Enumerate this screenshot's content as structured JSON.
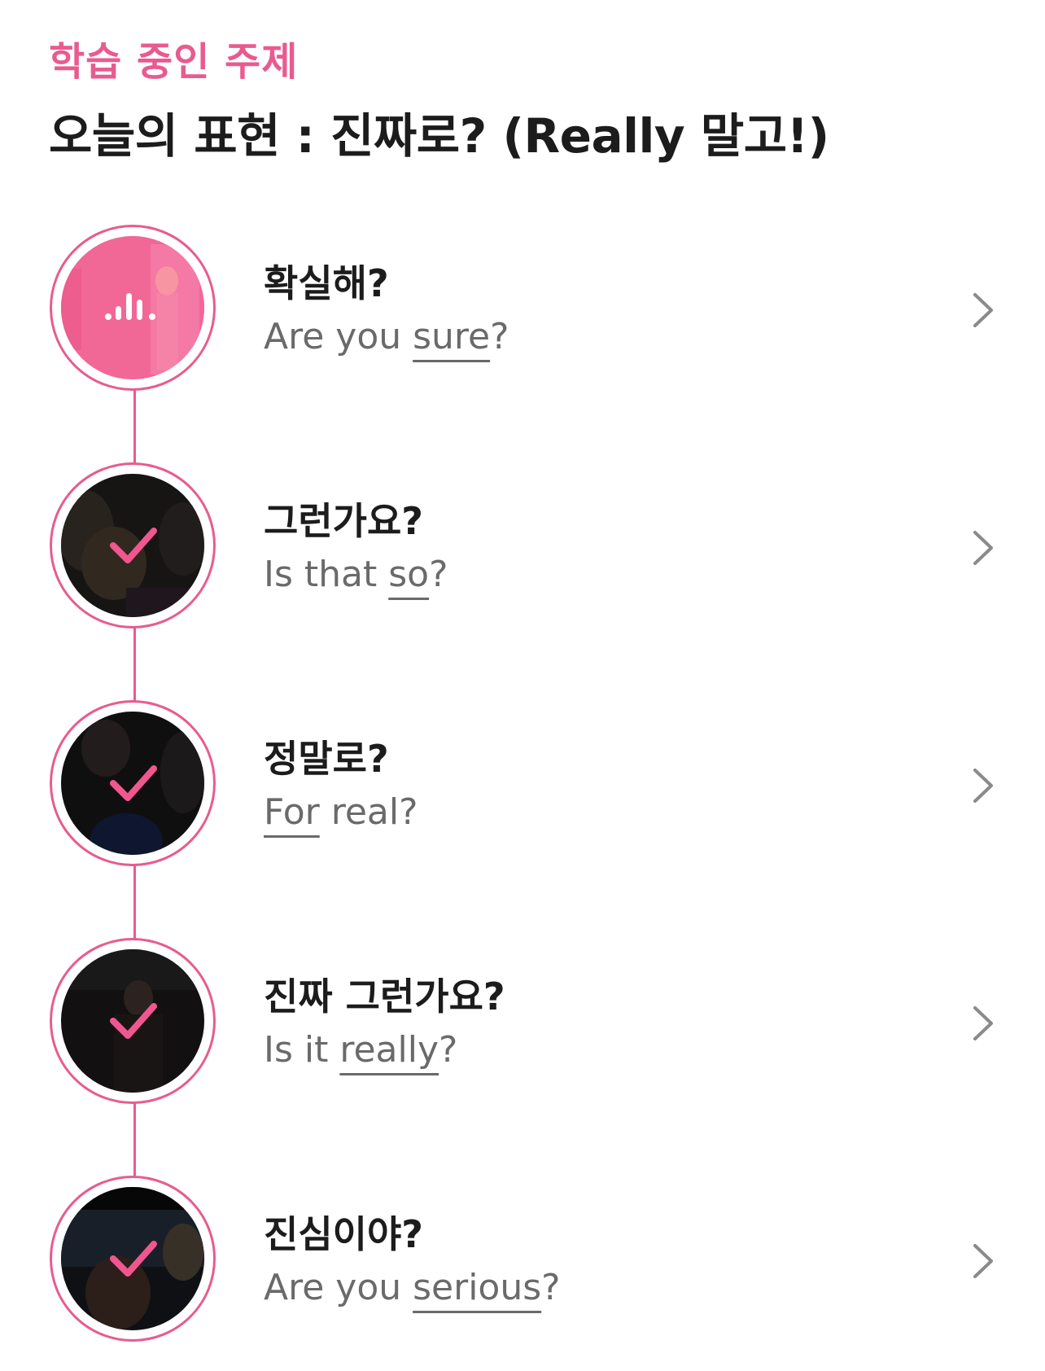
{
  "header": {
    "eyebrow": "학습 중인 주제",
    "title": "오늘의 표현 : 진짜로? (Really 말고!)"
  },
  "colors": {
    "accent": "#e85b8f",
    "text_primary": "#1c1c1c",
    "text_secondary": "#6a6a6a"
  },
  "items": [
    {
      "ko": "확실해?",
      "en_pre": "Are you ",
      "en_u": "sure",
      "en_post": "?",
      "state": "playing",
      "icon": "audio-wave-icon"
    },
    {
      "ko": "그런가요?",
      "en_pre": "Is that ",
      "en_u": "so",
      "en_post": "?",
      "state": "completed",
      "icon": "check-icon"
    },
    {
      "ko": "정말로?",
      "en_pre": "",
      "en_u": "For",
      "en_post": " real?",
      "state": "completed",
      "icon": "check-icon"
    },
    {
      "ko": "진짜 그런가요?",
      "en_pre": "Is it ",
      "en_u": "really",
      "en_post": "?",
      "state": "completed",
      "icon": "check-icon"
    },
    {
      "ko": "진심이야?",
      "en_pre": "Are you ",
      "en_u": "serious",
      "en_post": "?",
      "state": "completed",
      "icon": "check-icon"
    }
  ]
}
